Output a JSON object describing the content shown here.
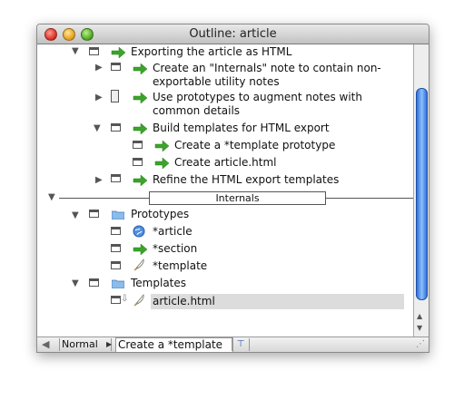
{
  "window": {
    "title": "Outline: article"
  },
  "rows": [
    {
      "label": "Exporting the article as HTML"
    },
    {
      "label_line1": "Create an \"Internals\" note to contain non-",
      "label_line2": "exportable utility notes"
    },
    {
      "label_line1": "Use prototypes to augment notes with",
      "label_line2": "common details"
    },
    {
      "label": "Build templates for HTML export"
    },
    {
      "label": "Create a *template prototype"
    },
    {
      "label": "Create article.html"
    },
    {
      "label": "Refine the HTML export templates"
    }
  ],
  "separator": {
    "label": "Internals"
  },
  "prototypes": {
    "label": "Prototypes",
    "items": [
      {
        "label": "*article",
        "icon": "globe-icon"
      },
      {
        "label": "*section",
        "icon": "green-arrow-icon"
      },
      {
        "label": "*template",
        "icon": "quill-icon"
      }
    ]
  },
  "templates": {
    "label": "Templates",
    "items": [
      {
        "label": "article.html",
        "icon": "quill-icon"
      }
    ]
  },
  "bottombar": {
    "mode": "Normal",
    "note_field": "Create a *template"
  },
  "colors": {
    "arrow_green": "#3aa52a",
    "selection": "#dcdcdc",
    "scroll_thumb": "#4a8ce8"
  }
}
